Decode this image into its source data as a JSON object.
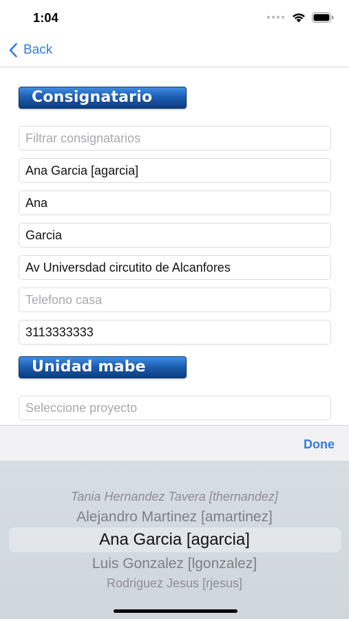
{
  "status_bar": {
    "time": "1:04"
  },
  "nav": {
    "back_label": "Back"
  },
  "sections": {
    "consignatario": "Consignatario",
    "unidad": "Unidad mabe"
  },
  "form": {
    "filter_placeholder": "Filtrar consignatarios",
    "consignee_value": "Ana Garcia [agarcia]",
    "first_name_value": "Ana",
    "last_name_value": "Garcia",
    "address_value": "Av Universdad circutito de Alcanfores",
    "home_phone_placeholder": "Telefono casa",
    "mobile_phone_value": "3113333333",
    "project_placeholder": "Seleccione proyecto"
  },
  "picker": {
    "done_label": "Done",
    "options": [
      "Tania Hernandez Tavera [thernandez]",
      "Alejandro Martinez [amartinez]",
      "Ana Garcia [agarcia]",
      "Luis Gonzalez [lgonzalez]",
      "Rodriguez Jesus [rjesus]"
    ],
    "selected": "Ana Garcia [agarcia]"
  },
  "colors": {
    "accent": "#2f7de1",
    "section_header": "#1d5fb3"
  },
  "icons": [
    "chevron-left-icon",
    "cellular-signal-icon",
    "wifi-icon",
    "battery-icon"
  ]
}
